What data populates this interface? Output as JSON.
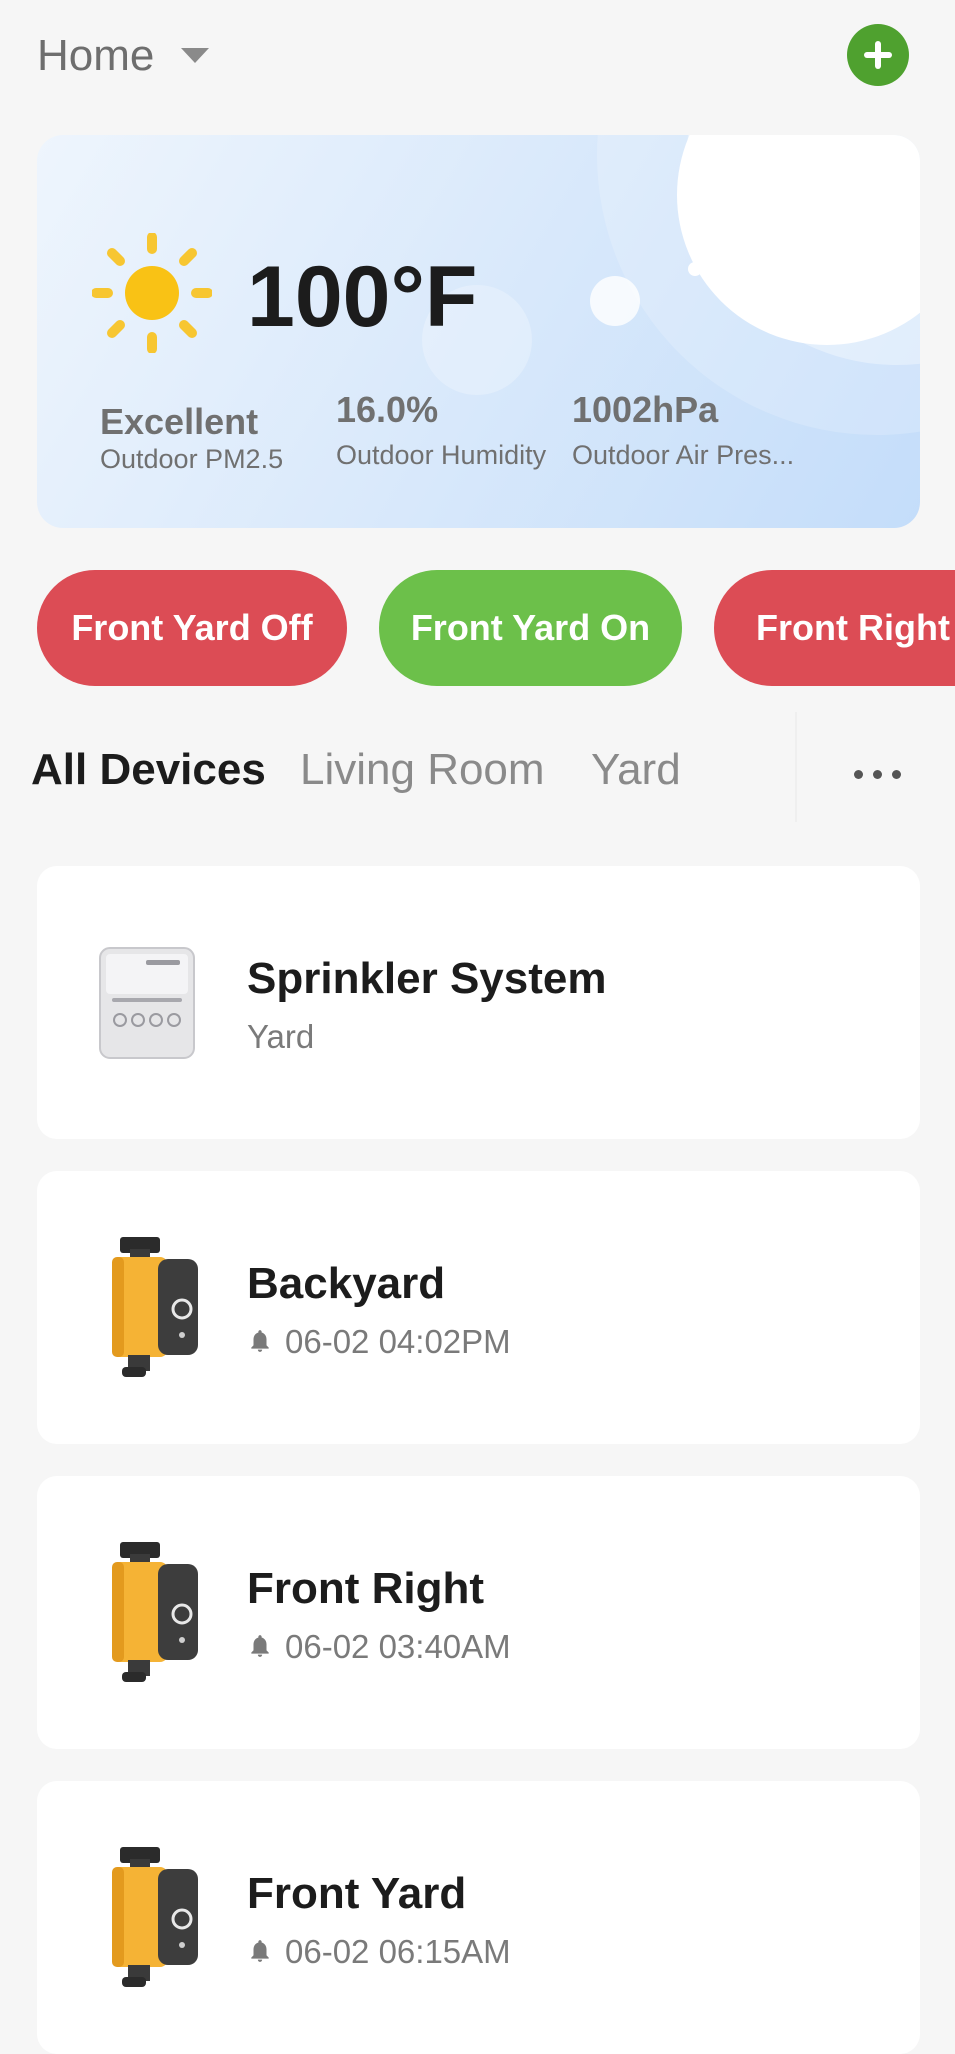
{
  "header": {
    "home_label": "Home",
    "add_icon": "plus-circle-icon"
  },
  "weather": {
    "icon": "sun-icon",
    "temperature": "100°F",
    "stats": [
      {
        "value": "Excellent",
        "label": "Outdoor PM2.5"
      },
      {
        "value": "16.0%",
        "label": "Outdoor Humidity"
      },
      {
        "value": "1002hPa",
        "label": "Outdoor Air Pres..."
      }
    ]
  },
  "scenes": [
    {
      "label": "Front Yard Off",
      "color": "#dc4c55"
    },
    {
      "label": "Front Yard On",
      "color": "#6cc04a"
    },
    {
      "label": "Front Right O",
      "color": "#dc4c55"
    }
  ],
  "tabs": {
    "items": [
      "All Devices",
      "Living Room",
      "Yard"
    ],
    "active": "All Devices",
    "more_icon": "more-horizontal-icon"
  },
  "devices": [
    {
      "name": "Sprinkler System",
      "subtitle": "Yard",
      "icon": "sprinkler-controller-image"
    },
    {
      "name": "Backyard",
      "subtitle": "06-02 04:02PM",
      "icon": "water-timer-image",
      "subtitle_icon": "bell-icon"
    },
    {
      "name": "Front Right",
      "subtitle": "06-02 03:40AM",
      "icon": "water-timer-image",
      "subtitle_icon": "bell-icon"
    },
    {
      "name": "Front Yard",
      "subtitle": "06-02 06:15AM",
      "icon": "water-timer-image",
      "subtitle_icon": "bell-icon"
    }
  ],
  "colors": {
    "accent_green": "#4fa12f",
    "scene_red": "#dc4c55",
    "scene_green": "#6cc04a"
  }
}
